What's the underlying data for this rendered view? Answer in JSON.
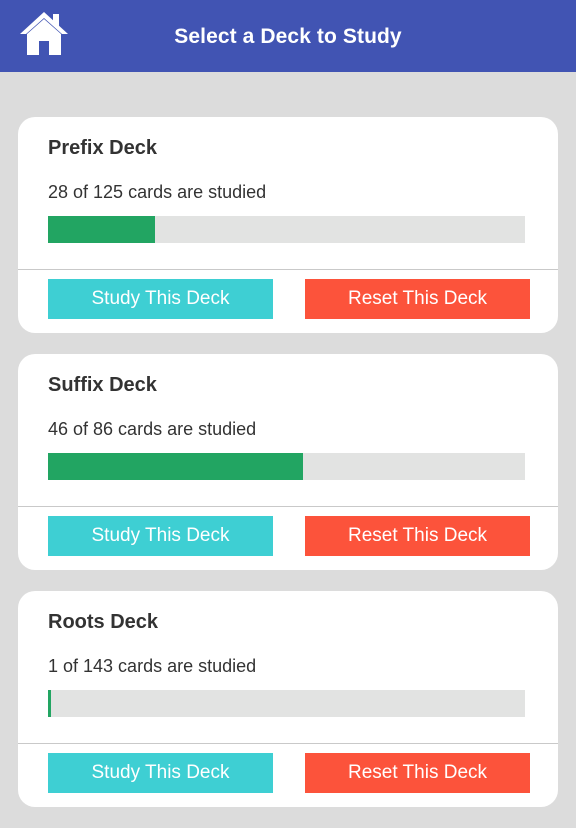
{
  "header": {
    "title": "Select a Deck to Study",
    "home_icon": "home-icon"
  },
  "colors": {
    "header_bg": "#4154b3",
    "page_bg": "#dcdcdc",
    "progress_fill": "#22a562",
    "progress_track": "#e2e3e2",
    "study_button": "#3ecfd3",
    "reset_button": "#fc533b"
  },
  "decks": [
    {
      "name": "Prefix Deck",
      "progress_text": "28 of 125 cards are studied",
      "studied": 28,
      "total": 125,
      "study_label": "Study This Deck",
      "reset_label": "Reset This Deck"
    },
    {
      "name": "Suffix Deck",
      "progress_text": "46 of 86 cards are studied",
      "studied": 46,
      "total": 86,
      "study_label": "Study This Deck",
      "reset_label": "Reset This Deck"
    },
    {
      "name": "Roots Deck",
      "progress_text": "1 of 143 cards are studied",
      "studied": 1,
      "total": 143,
      "study_label": "Study This Deck",
      "reset_label": "Reset This Deck"
    }
  ]
}
